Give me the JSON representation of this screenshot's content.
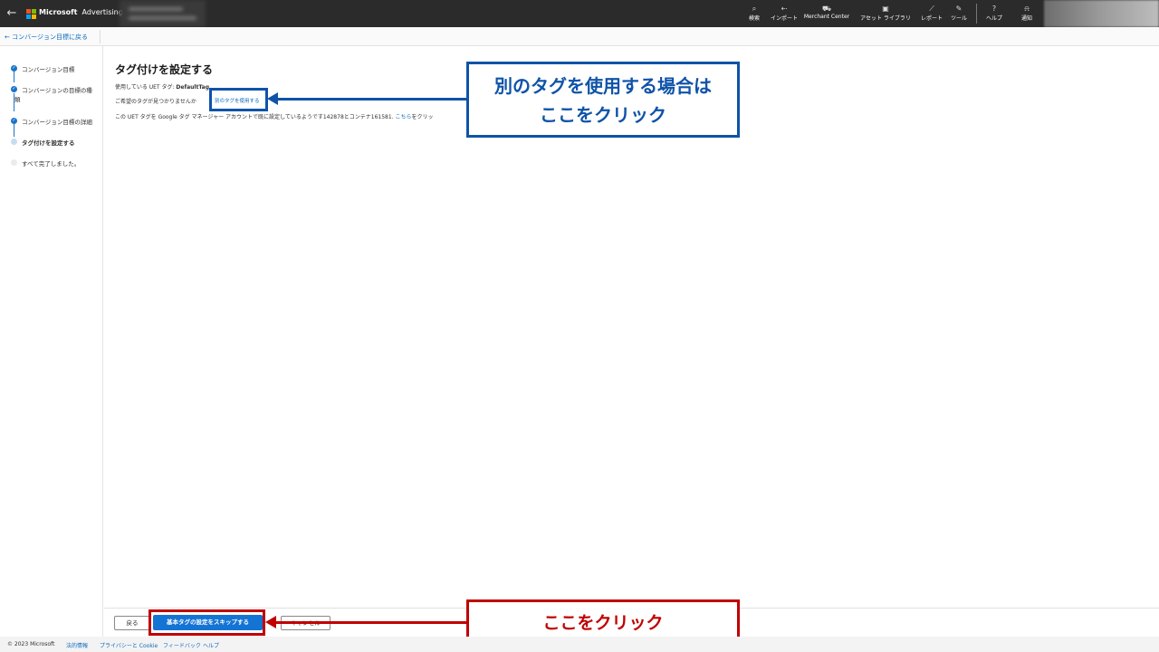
{
  "topbar": {
    "brand_primary": "Microsoft",
    "brand_secondary": "Advertising",
    "nav": [
      {
        "label": "検索",
        "icon": "search-icon",
        "glyph": "⌕"
      },
      {
        "label": "インポート",
        "icon": "import-icon",
        "glyph": "⇠"
      },
      {
        "label": "Merchant Center",
        "icon": "cart-icon",
        "glyph": "⛟"
      },
      {
        "label": "アセット ライブラリ",
        "icon": "asset-library-icon",
        "glyph": "▣"
      },
      {
        "label": "レポート",
        "icon": "report-icon",
        "glyph": "⟋"
      },
      {
        "label": "ツール",
        "icon": "tools-icon",
        "glyph": "✎"
      },
      {
        "label": "ヘルプ",
        "icon": "help-icon",
        "glyph": "?"
      },
      {
        "label": "通知",
        "icon": "bell-icon",
        "glyph": "⍾"
      }
    ]
  },
  "subbar": {
    "back_link": "← コンバージョン目標に戻る"
  },
  "steps": [
    {
      "label": "コンバージョン目標",
      "state": "done"
    },
    {
      "label": "コンバージョンの目標の種",
      "label2": "類",
      "state": "done"
    },
    {
      "label": "コンバージョン目標の詳細",
      "state": "done"
    },
    {
      "label": "タグ付けを設定する",
      "state": "current"
    },
    {
      "label": "すべて完了しました。",
      "state": "future"
    }
  ],
  "main": {
    "title": "タグ付けを設定する",
    "uet_prefix": "使用している UET タグ: ",
    "uet_name": "DefaultTag",
    "not_found": "ご希望のタグが見つかりませんか",
    "use_other_link": "別のタグを使用する",
    "gtm_text": "この UET タグを Google タグ マネージャー アカウントで既に設定しているようです142878とコンテナ161581. ",
    "gtm_link": "こちら",
    "gtm_suffix": "をクリッ"
  },
  "annotations": {
    "blue_line1": "別のタグを使用する場合は",
    "blue_line2": "ここをクリック",
    "red": "ここをクリック",
    "blue_color": "#0f53a8",
    "red_color": "#c00000"
  },
  "actions": {
    "back": "戻る",
    "skip": "基本タグの設定をスキップする",
    "cancel": "キャンセル"
  },
  "footer": {
    "copyright": "© 2023 Microsoft",
    "legal": "法的情報",
    "privacy": "プライバシーと Cookie",
    "feedback": "フィードバック",
    "help": "ヘルプ"
  }
}
